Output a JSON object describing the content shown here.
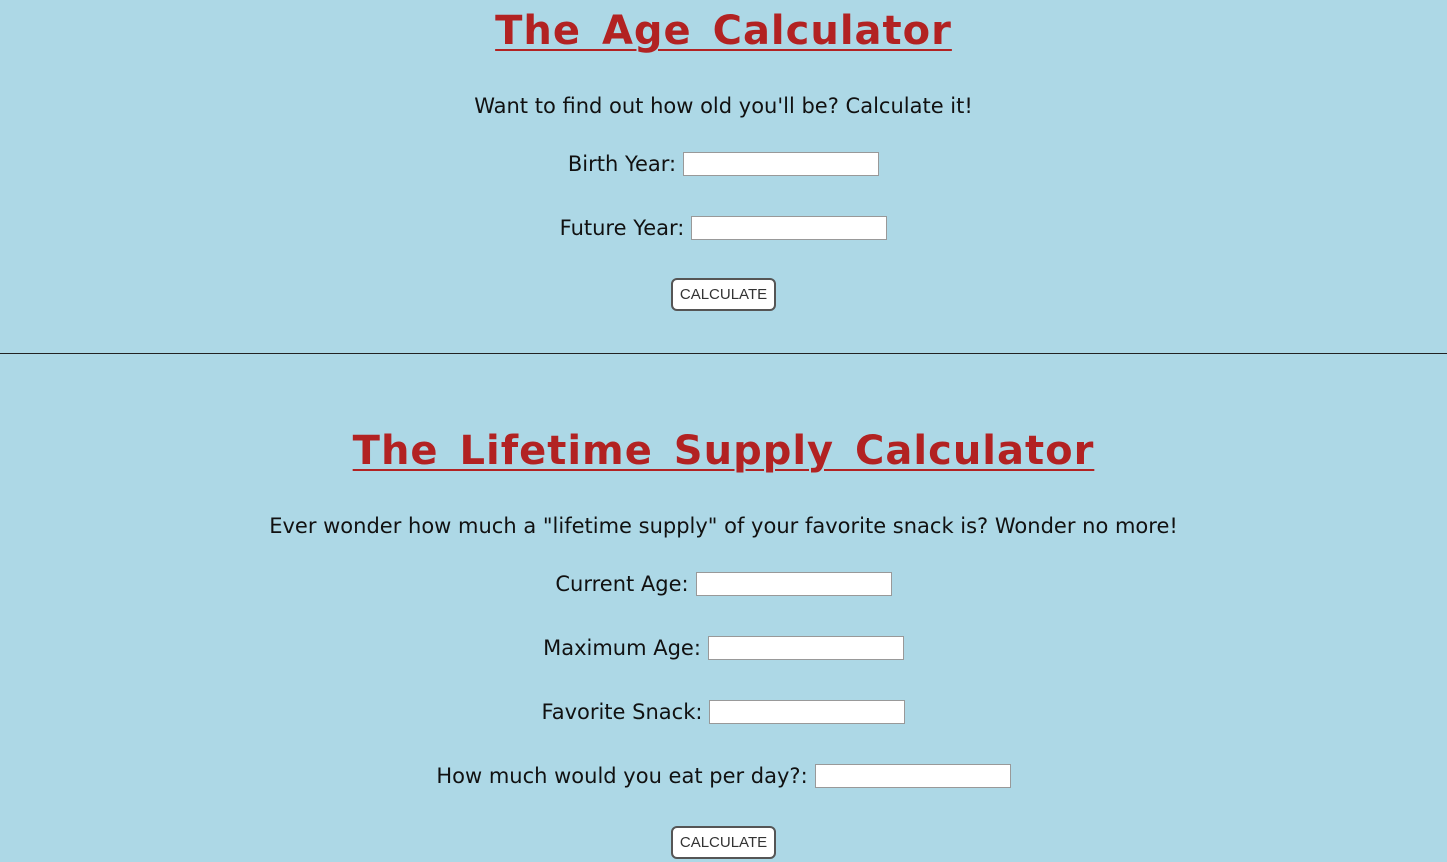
{
  "age_calculator": {
    "title": "The Age Calculator",
    "intro": "Want to find out how old you'll be? Calculate it!",
    "fields": [
      {
        "label": "Birth Year:",
        "value": ""
      },
      {
        "label": "Future Year:",
        "value": ""
      }
    ],
    "button_label": "CALCULATE"
  },
  "supply_calculator": {
    "title": "The Lifetime Supply Calculator",
    "intro": "Ever wonder how much a \"lifetime supply\" of your favorite snack is? Wonder no more!",
    "fields": [
      {
        "label": "Current Age:",
        "value": ""
      },
      {
        "label": "Maximum Age:",
        "value": ""
      },
      {
        "label": "Favorite Snack:",
        "value": ""
      },
      {
        "label": "How much would you eat per day?:",
        "value": ""
      }
    ],
    "button_label": "CALCULATE"
  },
  "colors": {
    "background": "#add8e6",
    "title": "#b22222"
  }
}
